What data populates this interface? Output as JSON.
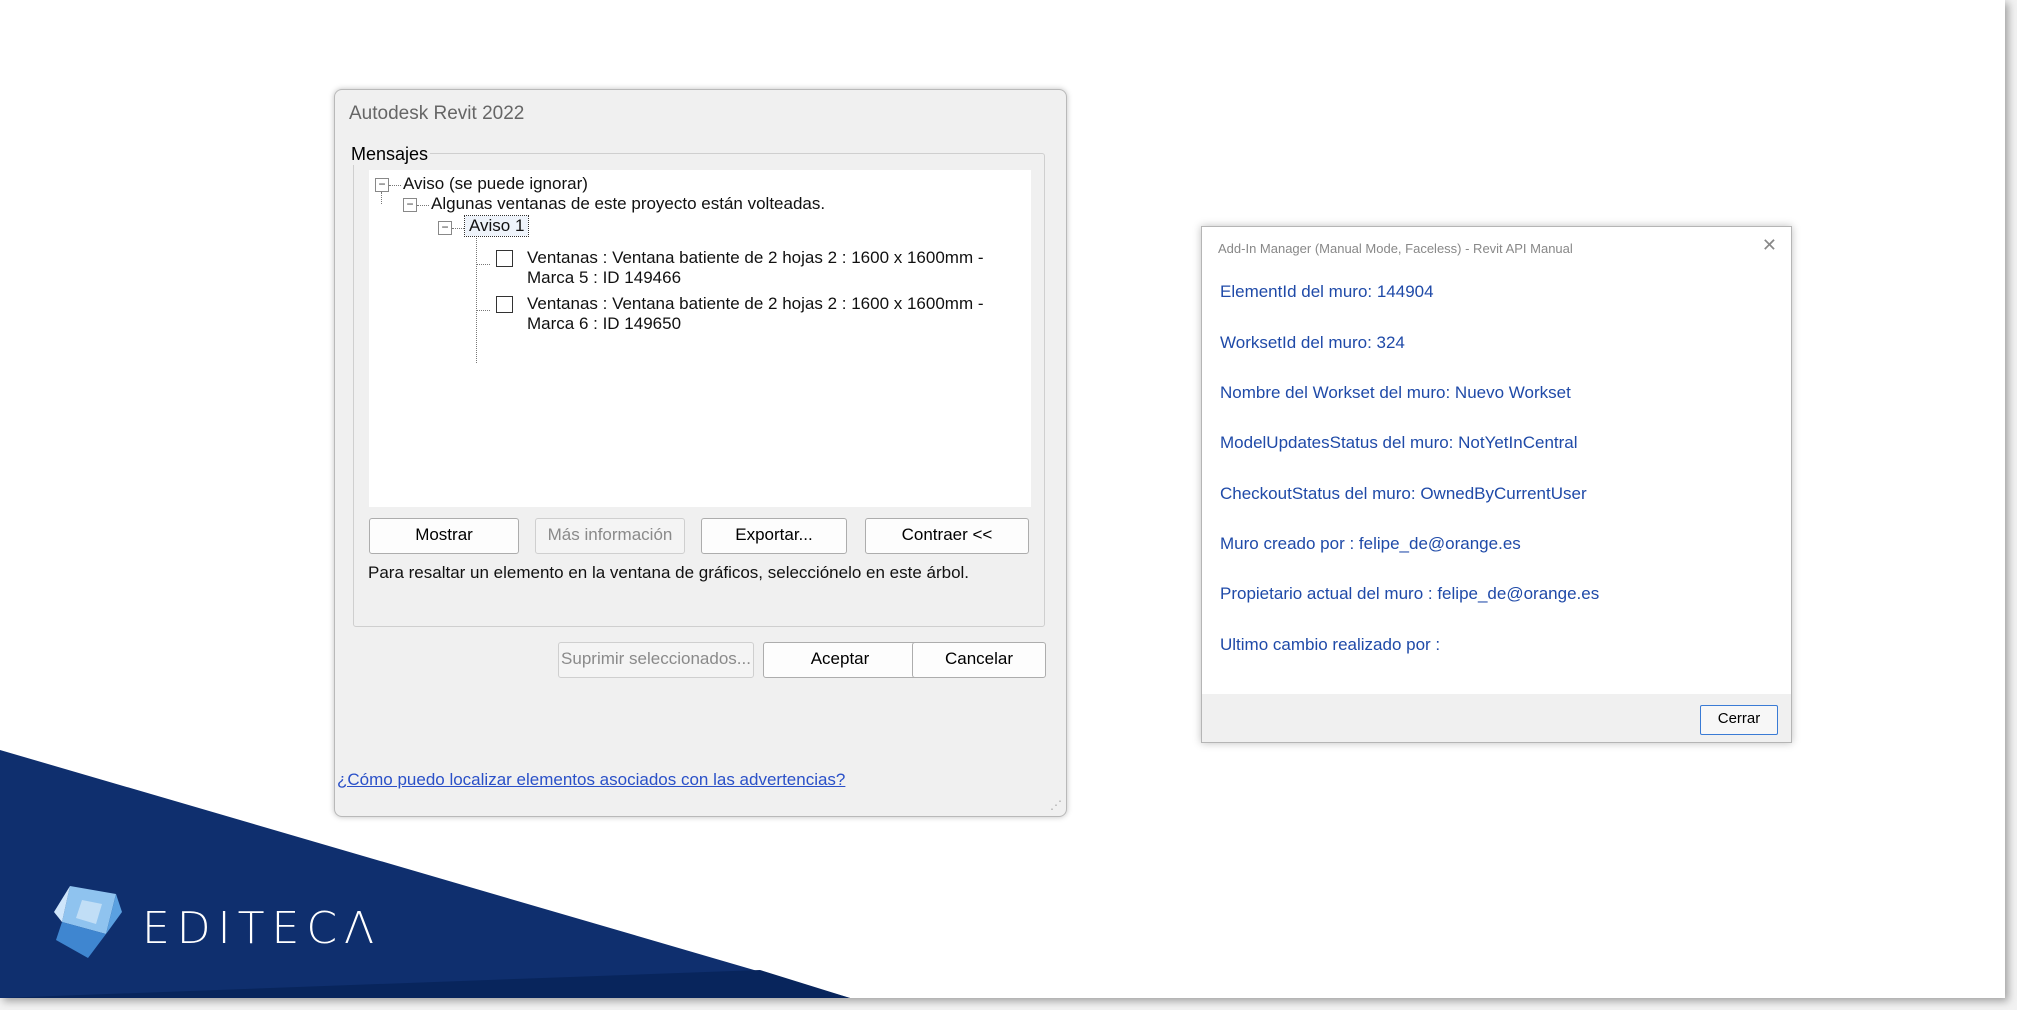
{
  "revit_dialog": {
    "title": "Autodesk Revit 2022",
    "group_label": "Mensajes",
    "tree": {
      "root": "Aviso (se puede ignorar)",
      "child": "Algunas ventanas de este proyecto están volteadas.",
      "warning": "Aviso 1",
      "items": [
        {
          "line1": "Ventanas : Ventana batiente de 2 hojas 2 : 1600 x 1600mm -",
          "line2": "Marca 5 : ID 149466"
        },
        {
          "line1": "Ventanas : Ventana batiente de 2 hojas 2 : 1600 x 1600mm -",
          "line2": "Marca 6 : ID 149650"
        }
      ]
    },
    "buttons": {
      "show": "Mostrar",
      "more_info": "Más información",
      "export": "Exportar...",
      "collapse": "Contraer <<",
      "suppress": "Suprimir seleccionados...",
      "ok": "Aceptar",
      "cancel": "Cancelar"
    },
    "hint": "Para resaltar un elemento en la ventana de gráficos, selecciónelo en este árbol.",
    "help_link": "¿Cómo puedo localizar elementos asociados con las advertencias?"
  },
  "addin_dialog": {
    "title": "Add-In Manager (Manual Mode, Faceless) - Revit API Manual",
    "close_glyph": "✕",
    "lines": [
      "ElementId del muro: 144904",
      "WorksetId del muro: 324",
      "Nombre del Workset del muro: Nuevo Workset",
      "ModelUpdatesStatus del muro: NotYetInCentral",
      "CheckoutStatus del muro: OwnedByCurrentUser",
      "Muro creado por : felipe_de@orange.es",
      "Propietario actual del muro : felipe_de@orange.es",
      "Ultimo cambio realizado por :"
    ],
    "close_button": "Cerrar"
  },
  "brand": {
    "name": "EDITECΛ",
    "band_color": "#0f2f6e"
  }
}
